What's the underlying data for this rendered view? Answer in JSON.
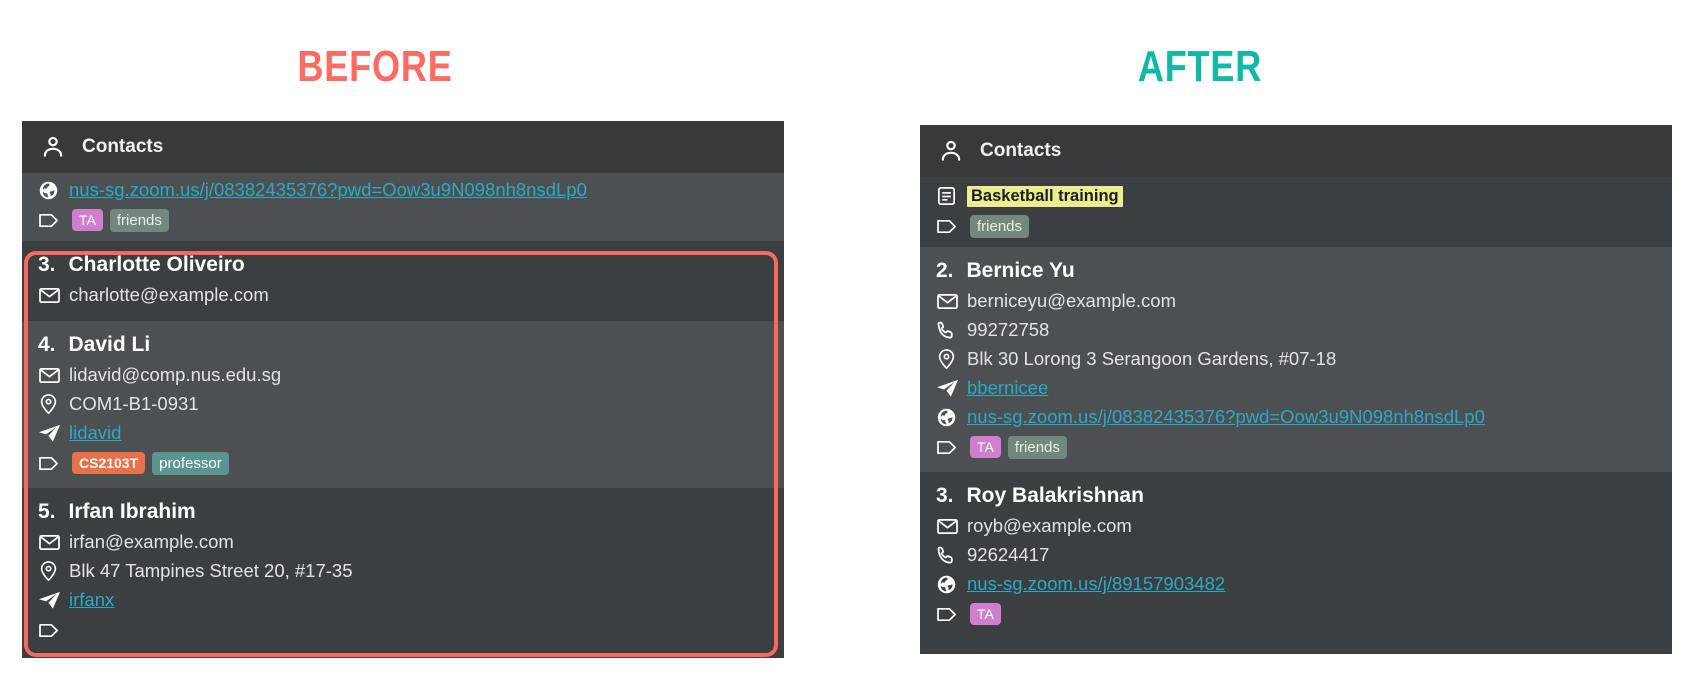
{
  "headings": {
    "before": "BEFORE",
    "after": "AFTER",
    "before_color": "#fd6b63",
    "after_color": "#0fb9a6"
  },
  "before_panel": {
    "header": {
      "title": "Contacts",
      "icon": "person-icon"
    },
    "partial_top_card": {
      "website": "nus-sg.zoom.us/j/08382435376?pwd=Oow3u9N098nh8nsdLp0",
      "tags": [
        "TA",
        "friends"
      ]
    },
    "contacts": [
      {
        "index": "3.",
        "name": "Charlotte Oliveiro",
        "email": "charlotte@example.com",
        "phone": "",
        "address": "",
        "telegram": "",
        "website": "",
        "tags": []
      },
      {
        "index": "4.",
        "name": "David Li",
        "email": "lidavid@comp.nus.edu.sg",
        "phone": "",
        "address": "COM1-B1-0931",
        "telegram": "lidavid",
        "website": "",
        "tags": [
          "CS2103T",
          "professor"
        ]
      },
      {
        "index": "5.",
        "name": "Irfan Ibrahim",
        "email": "irfan@example.com",
        "phone": "",
        "address": "Blk 47 Tampines Street 20, #17-35",
        "telegram": "irfanx",
        "website": "",
        "tags": []
      }
    ]
  },
  "after_panel": {
    "header": {
      "title": "Contacts",
      "icon": "person-icon"
    },
    "partial_top_card": {
      "event": "Basketball training",
      "tags": [
        "friends"
      ]
    },
    "contacts": [
      {
        "index": "2.",
        "name": "Bernice Yu",
        "email": "berniceyu@example.com",
        "phone": "99272758",
        "address": "Blk 30 Lorong 3 Serangoon Gardens, #07-18",
        "telegram": "bbernicee",
        "website": "nus-sg.zoom.us/j/08382435376?pwd=Oow3u9N098nh8nsdLp0",
        "tags": [
          "TA",
          "friends"
        ]
      },
      {
        "index": "3.",
        "name": "Roy Balakrishnan",
        "email": "royb@example.com",
        "phone": "92624417",
        "address": "",
        "telegram": "",
        "website": "nus-sg.zoom.us/j/89157903482",
        "tags": [
          "TA"
        ]
      }
    ]
  }
}
